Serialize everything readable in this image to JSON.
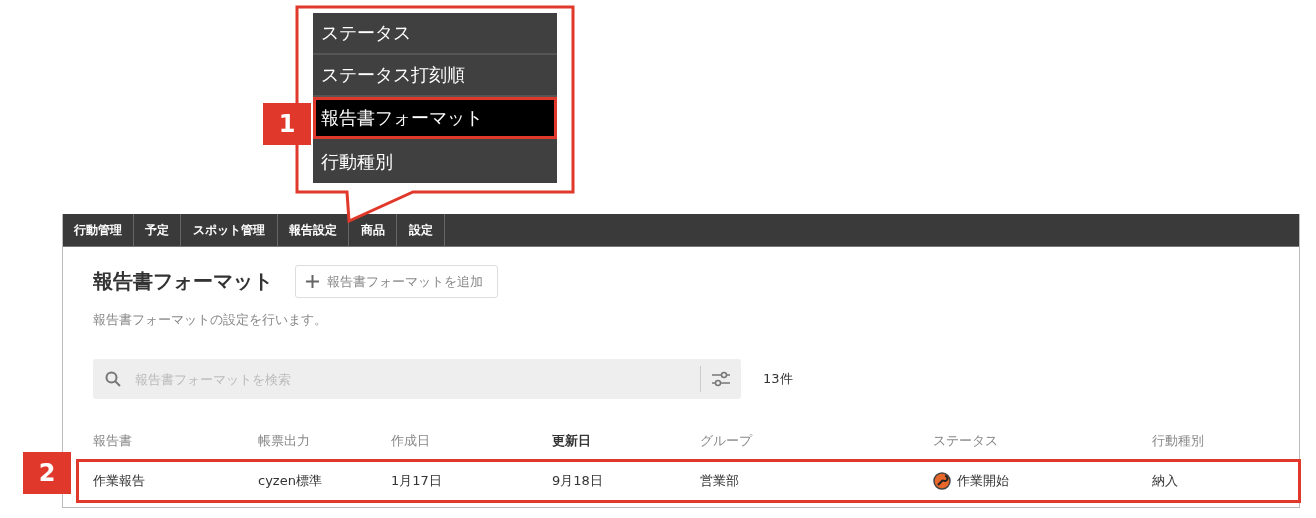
{
  "dropdown_menu": {
    "items": [
      {
        "label": "ステータス",
        "selected": false
      },
      {
        "label": "ステータス打刻順",
        "selected": false
      },
      {
        "label": "報告書フォーマット",
        "selected": true
      },
      {
        "label": "行動種別",
        "selected": false
      }
    ]
  },
  "callouts": [
    {
      "label": "1"
    },
    {
      "label": "2"
    }
  ],
  "nav_tabs": [
    {
      "label": "行動管理"
    },
    {
      "label": "予定"
    },
    {
      "label": "スポット管理"
    },
    {
      "label": "報告設定"
    },
    {
      "label": "商品"
    },
    {
      "label": "設定"
    }
  ],
  "page": {
    "title": "報告書フォーマット",
    "add_button": "報告書フォーマットを追加",
    "description": "報告書フォーマットの設定を行います。"
  },
  "search": {
    "placeholder": "報告書フォーマットを検索",
    "count": "13件"
  },
  "table": {
    "columns": [
      {
        "label": "報告書",
        "kind": "text",
        "sorted": false
      },
      {
        "label": "帳票出力",
        "kind": "text",
        "sorted": false
      },
      {
        "label": "作成日",
        "kind": "text",
        "sorted": false
      },
      {
        "label": "更新日",
        "kind": "text",
        "sorted": true
      },
      {
        "label": "グループ",
        "kind": "text",
        "sorted": false
      },
      {
        "label": "ステータス",
        "kind": "status",
        "sorted": false
      },
      {
        "label": "行動種別",
        "kind": "text",
        "sorted": false
      }
    ],
    "rows": [
      {
        "highlighted": true,
        "cells": [
          "作業報告",
          "cyzen標準",
          "1月17日",
          "9月18日",
          "営業部",
          "作業開始",
          "納入"
        ]
      }
    ]
  }
}
